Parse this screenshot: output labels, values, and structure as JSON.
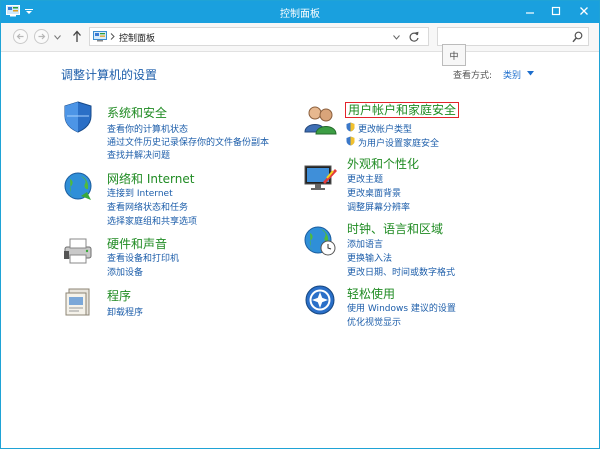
{
  "window": {
    "title": "控制面板"
  },
  "navbar": {
    "address_text": "控制面板",
    "search_placeholder": ""
  },
  "ime": {
    "label": "中"
  },
  "page": {
    "title": "调整计算机的设置",
    "view_by_label": "查看方式:",
    "view_by_value": "类别"
  },
  "categories": {
    "system": {
      "heading": "系统和安全",
      "links": [
        "查看你的计算机状态",
        "通过文件历史记录保存你的文件备份副本",
        "查找并解决问题"
      ]
    },
    "network": {
      "heading": "网络和 Internet",
      "links": [
        "连接到 Internet",
        "查看网络状态和任务",
        "选择家庭组和共享选项"
      ]
    },
    "hardware": {
      "heading": "硬件和声音",
      "links": [
        "查看设备和打印机",
        "添加设备"
      ]
    },
    "programs": {
      "heading": "程序",
      "links": [
        "卸载程序"
      ]
    },
    "users": {
      "heading": "用户帐户和家庭安全",
      "links": [
        "更改帐户类型",
        "为用户设置家庭安全"
      ]
    },
    "appearance": {
      "heading": "外观和个性化",
      "links": [
        "更改主题",
        "更改桌面背景",
        "调整屏幕分辨率"
      ]
    },
    "clock": {
      "heading": "时钟、语言和区域",
      "links": [
        "添加语言",
        "更换输入法",
        "更改日期、时间或数字格式"
      ]
    },
    "ease": {
      "heading": "轻松使用",
      "links": [
        "使用 Windows 建议的设置",
        "优化视觉显示"
      ]
    }
  },
  "colors": {
    "titlebar": "#1aa0de",
    "heading_green": "#1f8b22",
    "link_blue": "#1d5eaa",
    "highlight_box": "#e3242b"
  }
}
